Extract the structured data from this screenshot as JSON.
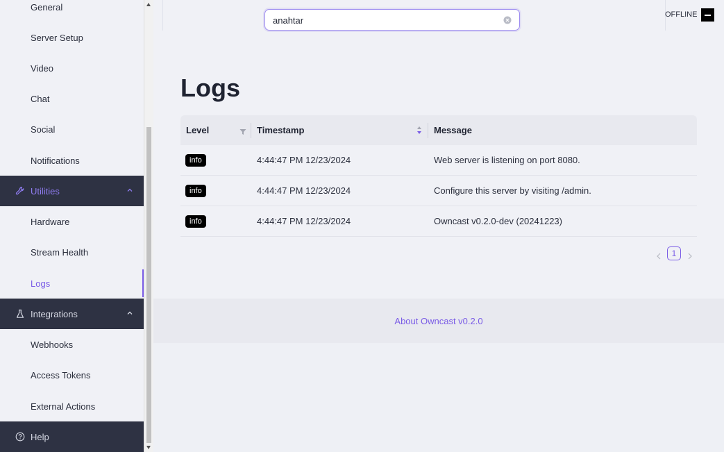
{
  "sidebar": {
    "items": [
      {
        "label": "General"
      },
      {
        "label": "Server Setup"
      },
      {
        "label": "Video"
      },
      {
        "label": "Chat"
      },
      {
        "label": "Social"
      },
      {
        "label": "Notifications"
      }
    ],
    "utilities": {
      "label": "Utilities",
      "icon": "wrench-icon",
      "items": [
        {
          "label": "Hardware"
        },
        {
          "label": "Stream Health"
        },
        {
          "label": "Logs"
        }
      ]
    },
    "integrations": {
      "label": "Integrations",
      "icon": "flask-icon",
      "items": [
        {
          "label": "Webhooks"
        },
        {
          "label": "Access Tokens"
        },
        {
          "label": "External Actions"
        }
      ]
    },
    "help": {
      "label": "Help",
      "icon": "question-circle-icon"
    }
  },
  "header": {
    "search_value": "anahtar",
    "status": "OFFLINE"
  },
  "main": {
    "title": "Logs",
    "table": {
      "columns": [
        "Level",
        "Timestamp",
        "Message"
      ],
      "rows": [
        {
          "level": "info",
          "timestamp": "4:44:47 PM 12/23/2024",
          "message": "Web server is listening on port 8080."
        },
        {
          "level": "info",
          "timestamp": "4:44:47 PM 12/23/2024",
          "message": "Configure this server by visiting /admin."
        },
        {
          "level": "info",
          "timestamp": "4:44:47 PM 12/23/2024",
          "message": "Owncast v0.2.0-dev (20241223)"
        }
      ]
    },
    "pagination": {
      "current": "1"
    }
  },
  "footer": {
    "link": "About Owncast v0.2.0"
  },
  "colors": {
    "accent": "#7a5ce6",
    "sidebar_group_bg": "#2e3243",
    "badge_bg": "#000000"
  }
}
